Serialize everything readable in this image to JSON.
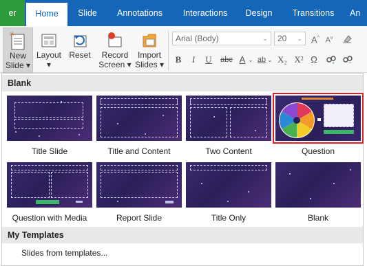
{
  "tabs": {
    "file": "er",
    "home": "Home",
    "slide": "Slide",
    "annotations": "Annotations",
    "interactions": "Interactions",
    "design": "Design",
    "transitions": "Transitions",
    "more": "An"
  },
  "ribbon": {
    "new_slide_line1": "New",
    "new_slide_line2": "Slide ▾",
    "layout": "Layout",
    "layout_caret": "▾",
    "reset": "Reset",
    "record_line1": "Record",
    "record_line2": "Screen ▾",
    "import_line1": "Import",
    "import_line2": "Slides ▾",
    "font_name": "Arial (Body)",
    "font_size": "20",
    "caret": "⌄",
    "format_buttons": [
      "B",
      "I",
      "U",
      "abc",
      "A",
      "ab",
      "X₂",
      "X²",
      "Ω"
    ]
  },
  "panel": {
    "section_blank": "Blank",
    "section_templates": "My Templates",
    "from_templates": "Slides from templates...",
    "layouts": [
      "Title Slide",
      "Title and Content",
      "Two Content",
      "Question",
      "Question with Media",
      "Report Slide",
      "Title Only",
      "Blank"
    ],
    "selected_layout": "Question"
  },
  "colors": {
    "tab_bar": "#1565b8",
    "file_tab": "#2e9b3a",
    "selection": "#e02020",
    "thumb_bg": "#2b1f5a"
  }
}
